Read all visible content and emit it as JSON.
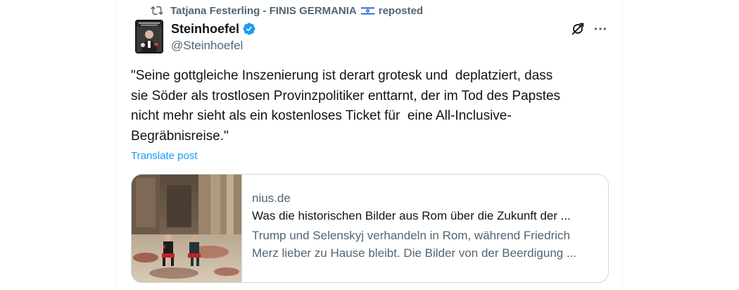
{
  "repost": {
    "user": "Tatjana Festerling - FINIS GERMANIA",
    "flag_icon": "israel-flag-icon",
    "action": "reposted"
  },
  "author": {
    "name": "Steinhoefel",
    "handle": "@Steinhoefel",
    "verified": true,
    "avatar_text": "DIE BILDER PROVINZ"
  },
  "post": {
    "text_lines": [
      "\"Seine gottgleiche Inszenierung ist derart grotesk und  deplatziert, dass",
      "sie Söder als trostlosen Provinzpolitiker enttarnt, der im Tod des Papstes",
      "nicht mehr sieht als ein kostenloses Ticket für  eine All-Inclusive-",
      "Begräbnisreise.\""
    ],
    "translate_label": "Translate post"
  },
  "link_card": {
    "domain": "nius.de",
    "title": "Was die historischen Bilder aus Rom über die Zukunft der ...",
    "description_lines": [
      "Trump und Selenskyj verhandeln in Rom, während Friedrich",
      "Merz lieber zu Hause bleibt. Die Bilder von der Beerdigung ..."
    ]
  },
  "colors": {
    "text": "#0f1419",
    "secondary": "#536471",
    "link": "#1d9bf0",
    "verified": "#1d9bf0",
    "border": "#cfd9de"
  },
  "icons": {
    "repost": "repost-icon",
    "verified": "verified-badge-icon",
    "grok": "grok-icon",
    "more": "more-options-icon"
  }
}
